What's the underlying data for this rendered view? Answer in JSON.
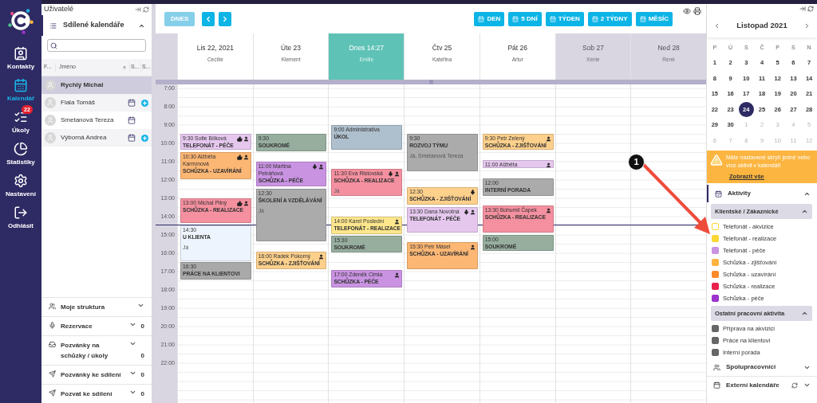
{
  "nav": [
    {
      "label": "Kontakty",
      "selected": false
    },
    {
      "label": "Kalendář",
      "selected": true
    },
    {
      "label": "Úkoly",
      "selected": false,
      "badge": "22"
    },
    {
      "label": "Statistiky",
      "selected": false
    },
    {
      "label": "Nastavení",
      "selected": false
    },
    {
      "label": "Odhlásit",
      "selected": false
    }
  ],
  "users": {
    "title": "Uživatelé",
    "section": {
      "label": "Sdílené kalendáře",
      "expanded": true
    },
    "columns": [
      "F...",
      "Jméno",
      "S...",
      "S..."
    ],
    "rows": [
      {
        "name": "Rychlý Michal",
        "selected": true
      },
      {
        "name": "Fiala Tomáš",
        "selected": false,
        "has_calendar": true,
        "has_add": true
      },
      {
        "name": "Smetanová Tereza",
        "selected": false,
        "has_calendar": true
      },
      {
        "name": "Výborná Andrea",
        "selected": false,
        "has_calendar": true,
        "has_add": true
      }
    ],
    "sections": [
      {
        "label": "Moje struktura"
      },
      {
        "label": "Rezervace",
        "count": "0"
      },
      {
        "label": "Pozvánky na schůzky / úkoly",
        "count": "0"
      },
      {
        "label": "Pozvánky ke sdílení",
        "count": "0"
      },
      {
        "label": "Pozvat ke sdílení",
        "count": "0"
      }
    ]
  },
  "toolbar": {
    "today": {
      "label": "DNES",
      "disabled": true
    },
    "views": [
      {
        "label": "DEN"
      },
      {
        "label": "5 DNÍ"
      },
      {
        "label": "TÝDEN"
      },
      {
        "label": "2 TÝDNY"
      },
      {
        "label": "MĚSÍC"
      }
    ]
  },
  "hours": [
    "7:00",
    "8:00",
    "9:00",
    "10:00",
    "11:00",
    "12:00",
    "13:00",
    "14:00",
    "15:00",
    "16:00",
    "17:00",
    "18:00",
    "19:00",
    "20:00",
    "21:00",
    "22:00"
  ],
  "days": [
    {
      "label": "Lis 22, 2021",
      "name": "Cecílie",
      "kind": "workday",
      "events": [
        {
          "time": "9:30 Sofie Bílková",
          "title": "TELEFONÁT - PÉČE",
          "color": "#e5c7ee",
          "thumbs_up": true,
          "person": true
        },
        {
          "time": "10:30 Alžběta Karmínová",
          "title": "SCHŮZKA - UZAVÍRÁNÍ",
          "color": "#fdb774",
          "thumbs_up": true,
          "person": true
        },
        {
          "time": "13:00 Michal Pilný",
          "title": "SCHŮZKA - REALIZACE",
          "color": "#f4909f",
          "thumbs_up": true,
          "person": true
        },
        {
          "time": "14:30",
          "title": "U KLIENTA",
          "people": "Já",
          "color": "#eef4fd"
        },
        {
          "time": "16:30",
          "title": "PRÁCE NA KLIENTOVI",
          "color": "#a9a9a9"
        }
      ]
    },
    {
      "label": "Úte 23",
      "name": "Klement",
      "kind": "workday",
      "events": [
        {
          "time": "9:30",
          "title": "SOUKROMÉ",
          "color": "#97ae9f"
        },
        {
          "time": "11:00 Martina Petráňová",
          "title": "SCHŮZKA - PÉČE",
          "color": "#c993e2",
          "microphone": true,
          "person": true
        },
        {
          "time": "12:30",
          "title": "ŠKOLENÍ A VZDĚLÁVÁNÍ",
          "people": "Já",
          "color": "#ababab"
        },
        {
          "time": "16:00 Radek Pokorný",
          "title": "SCHŮZKA - ZJIŠŤOVÁNÍ",
          "color": "#fdd08c",
          "person": true
        }
      ]
    },
    {
      "label": "Dnes 14:27",
      "name": "Emilie",
      "kind": "today",
      "events": [
        {
          "time": "9:00 Administrativa",
          "title": "ÚKOL",
          "color": "#aebfcd"
        },
        {
          "time": "11:30 Eva Ristovská",
          "title": "SCHŮZKA - REALIZACE",
          "people": "Já",
          "color": "#f4909f",
          "microphone": true,
          "person": true
        },
        {
          "time": "14:00 Karel Poslední",
          "title": "TELEFONÁT - REALIZACE",
          "color": "#fde68c",
          "person": true
        },
        {
          "time": "15:30",
          "title": "SOUKROMÉ",
          "color": "#97ae9f"
        },
        {
          "time": "17:00 Zdeněk Cimla",
          "title": "SCHŮZKA - PÉČE",
          "color": "#c993e2",
          "person": true
        }
      ]
    },
    {
      "label": "Čtv 25",
      "name": "Kateřina",
      "kind": "workday",
      "events": [
        {
          "time": "9:30",
          "title": "ROZVOJ TÝMU",
          "people": "Já, Smetanová Tereza",
          "color": "#ababab"
        },
        {
          "time": "12:30",
          "title": "SCHŮZKA - ZJIŠŤOVÁNÍ",
          "color": "#fdd08c",
          "microphone": true
        },
        {
          "time": "13:30 Dana Novotná",
          "title": "TELEFONÁT - PÉČE",
          "color": "#e5c7ee",
          "microphone": true,
          "person": true
        },
        {
          "time": "15:30 Petr Másel",
          "title": "SCHŮZKA - UZAVÍRÁNÍ",
          "color": "#fdb774",
          "person": true
        }
      ]
    },
    {
      "label": "Pát 26",
      "name": "Artur",
      "kind": "workday",
      "events": [
        {
          "time": "9:30 Petr Zelený",
          "title": "SCHŮZKA - ZJIŠŤOVÁNÍ",
          "color": "#fdd08c",
          "person": true
        },
        {
          "time": "11:00 Alžběta",
          "color": "#e5c7ee",
          "person": true
        },
        {
          "time": "12:00",
          "title": "INTERNÍ PORADA",
          "color": "#ababab"
        },
        {
          "time": "13:30 Bohumil Čapek",
          "title": "SCHŮZKA - REALIZACE",
          "color": "#f4909f",
          "person": true
        },
        {
          "time": "15:00",
          "title": "SOUKROMÉ",
          "color": "#97ae9f"
        }
      ]
    },
    {
      "label": "Sob 27",
      "name": "Xenie",
      "kind": "weekend"
    },
    {
      "label": "Ned 28",
      "name": "René",
      "kind": "weekend"
    }
  ],
  "calendar": {
    "month": "Listopad 2021",
    "weekdays": [
      "P",
      "Ú",
      "S",
      "Č",
      "P",
      "S",
      "N"
    ],
    "days": [
      {
        "label": "1",
        "outside": false,
        "selected": false
      },
      {
        "label": "2",
        "outside": false,
        "selected": false
      },
      {
        "label": "3",
        "outside": false,
        "selected": false
      },
      {
        "label": "4",
        "outside": false,
        "selected": false
      },
      {
        "label": "5",
        "outside": false,
        "selected": false
      },
      {
        "label": "6",
        "outside": false,
        "selected": false
      },
      {
        "label": "7",
        "outside": false,
        "selected": false
      },
      {
        "label": "8",
        "outside": false,
        "selected": false
      },
      {
        "label": "9",
        "outside": false,
        "selected": false
      },
      {
        "label": "10",
        "outside": false,
        "selected": false
      },
      {
        "label": "11",
        "outside": false,
        "selected": false
      },
      {
        "label": "12",
        "outside": false,
        "selected": false
      },
      {
        "label": "13",
        "outside": false,
        "selected": false
      },
      {
        "label": "14",
        "outside": false,
        "selected": false
      },
      {
        "label": "15",
        "outside": false,
        "selected": false
      },
      {
        "label": "16",
        "outside": false,
        "selected": false
      },
      {
        "label": "17",
        "outside": false,
        "selected": false
      },
      {
        "label": "18",
        "outside": false,
        "selected": false
      },
      {
        "label": "19",
        "outside": false,
        "selected": false
      },
      {
        "label": "20",
        "outside": false,
        "selected": false
      },
      {
        "label": "21",
        "outside": false,
        "selected": false
      },
      {
        "label": "22",
        "outside": false,
        "selected": false
      },
      {
        "label": "23",
        "outside": false,
        "selected": false
      },
      {
        "label": "24",
        "outside": false,
        "selected": true
      },
      {
        "label": "25",
        "outside": false,
        "selected": false
      },
      {
        "label": "26",
        "outside": false,
        "selected": false
      },
      {
        "label": "27",
        "outside": false,
        "selected": false
      },
      {
        "label": "28",
        "outside": false,
        "selected": false
      },
      {
        "label": "29",
        "outside": false,
        "selected": false
      },
      {
        "label": "30",
        "outside": false,
        "selected": false
      },
      {
        "label": "1",
        "outside": true,
        "selected": false
      },
      {
        "label": "2",
        "outside": true,
        "selected": false
      },
      {
        "label": "3",
        "outside": true,
        "selected": false
      },
      {
        "label": "4",
        "outside": true,
        "selected": false
      },
      {
        "label": "5",
        "outside": true,
        "selected": false
      },
      {
        "label": "6",
        "outside": true,
        "selected": false
      },
      {
        "label": "7",
        "outside": true,
        "selected": false
      },
      {
        "label": "8",
        "outside": true,
        "selected": false
      },
      {
        "label": "9",
        "outside": true,
        "selected": false
      },
      {
        "label": "10",
        "outside": true,
        "selected": false
      },
      {
        "label": "11",
        "outside": true,
        "selected": false
      },
      {
        "label": "12",
        "outside": true,
        "selected": false
      }
    ]
  },
  "warning": {
    "text": "Máte nastavené skrytí jedné nebo více aktivit v kalendáři",
    "link": "Zobrazit vše"
  },
  "activities": {
    "label": "Aktivity",
    "expanded": true,
    "groups": [
      {
        "label": "Klientské / Zákaznické",
        "expanded": true,
        "items": [
          {
            "label": "Telefonát - akvizice",
            "color": "#fdd835",
            "checked": false
          },
          {
            "label": "Telefonát - realizace",
            "color": "#fdd835",
            "checked": true
          },
          {
            "label": "Telefonát - péče",
            "color": "#c993e2",
            "checked": true
          },
          {
            "label": "Schůzka - zjišťování",
            "color": "#fdb440",
            "checked": true
          },
          {
            "label": "Schůzka - uzavírání",
            "color": "#fd8b2a",
            "checked": true
          },
          {
            "label": "Schůzka - realizace",
            "color": "#e9214c",
            "checked": true
          },
          {
            "label": "Schůzka - péče",
            "color": "#9c33cc",
            "checked": true
          }
        ]
      },
      {
        "label": "Ostatní pracovní aktivita",
        "expanded": true,
        "items": [
          {
            "label": "Příprava na akvizici",
            "color": "#666666",
            "checked": true
          },
          {
            "label": "Práce na klientovi",
            "color": "#666666",
            "checked": true
          },
          {
            "label": "Interní porada",
            "color": "#666666",
            "checked": true
          }
        ]
      }
    ]
  },
  "collaborators": {
    "label": "Spolupracovníci",
    "expanded": false
  },
  "external": {
    "label": "Externí kalendáře",
    "expanded": false
  },
  "annotation": {
    "label": "1"
  }
}
